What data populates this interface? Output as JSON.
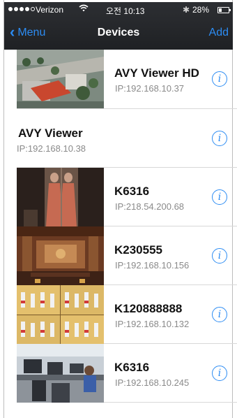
{
  "status_bar": {
    "carrier": "Verizon",
    "time": "오전 10:13",
    "battery_percent": "28%",
    "battery_level": 0.28,
    "signal_bars_filled": 4,
    "signal_bars_total": 5
  },
  "nav": {
    "back_label": "Menu",
    "title": "Devices",
    "add_label": "Add"
  },
  "accent_color": "#2c8cf3",
  "devices": [
    {
      "name": "AVY Viewer HD",
      "ip": "IP:192.168.10.37",
      "thumbnail": "aerial-city-view"
    },
    {
      "name": "AVY Viewer",
      "ip": "IP:192.168.10.38",
      "thumbnail": ""
    },
    {
      "name": "K6316",
      "ip": "IP:218.54.200.68",
      "thumbnail": "mirrored-woman-in-dress"
    },
    {
      "name": "K230555",
      "ip": "IP:192.168.10.156",
      "thumbnail": "ornate-hall-interior"
    },
    {
      "name": "K120888888",
      "ip": "IP:192.168.10.132",
      "thumbnail": "dance-performance-grid"
    },
    {
      "name": "K6316",
      "ip": "IP:192.168.10.245",
      "thumbnail": "office-workstations"
    }
  ]
}
